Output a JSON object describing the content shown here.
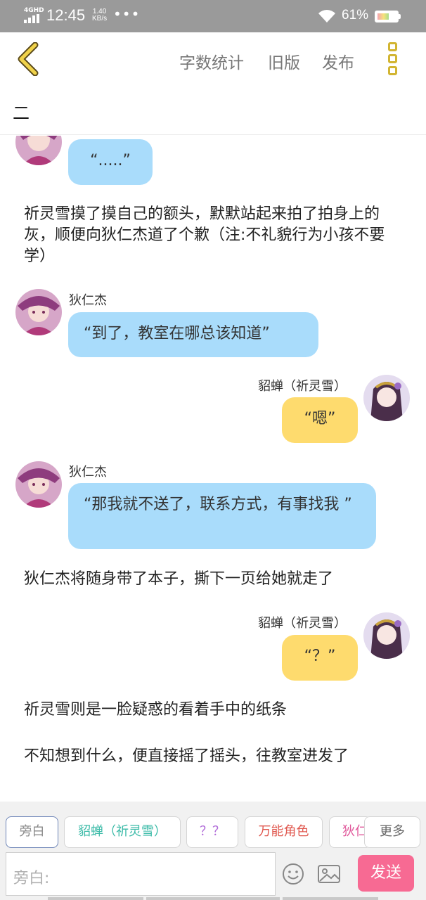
{
  "status_bar": {
    "network": "4GHD",
    "time": "12:45",
    "speed_value": "1.40",
    "speed_unit": "KB/s",
    "more": "•••",
    "battery_pct": "61%",
    "battery_level": 0.61
  },
  "header": {
    "word_count": "字数统计",
    "old_version": "旧版",
    "publish": "发布"
  },
  "title": "二",
  "chat": [
    {
      "type": "left",
      "bubble": "“.....”"
    },
    {
      "type": "narration",
      "text": "祈灵雪摸了摸自己的额头，默默站起来拍了拍身上的灰，顺便向狄仁杰道了个歉（注:不礼貌行为小孩不要学）"
    },
    {
      "type": "left",
      "speaker": "狄仁杰",
      "bubble": "“到了，教室在哪总该知道”"
    },
    {
      "type": "right",
      "speaker": "貂蝉（祈灵雪）",
      "bubble": "“嗯”"
    },
    {
      "type": "left",
      "speaker": "狄仁杰",
      "bubble": "“那我就不送了，联系方式，有事找我 ”"
    },
    {
      "type": "narration",
      "text": "狄仁杰将随身带了本子，撕下一页给她就走了"
    },
    {
      "type": "right",
      "speaker": "貂蝉（祈灵雪）",
      "bubble": "“？”"
    },
    {
      "type": "narration",
      "text": "祈灵雪则是一脸疑惑的看着手中的纸条"
    },
    {
      "type": "narration",
      "text": "不知想到什么，便直接摇了摇头，往教室进发了"
    }
  ],
  "roles": [
    {
      "label": "旁白",
      "color": "#8a8a8a"
    },
    {
      "label": "貂蝉（祈灵雪）",
      "color": "#3cbba8"
    },
    {
      "label": "？？",
      "color": "#b06bd8"
    },
    {
      "label": "万能角色",
      "color": "#e0584f"
    },
    {
      "label": "狄仁杰",
      "color": "#e0579a"
    }
  ],
  "more_roles": "更多",
  "input": {
    "placeholder": "旁白:"
  },
  "icons": {
    "back": "back-chevron-icon",
    "menu": "more-menu-icon",
    "emoji": "emoji-icon",
    "image": "image-icon"
  },
  "send": "发送"
}
